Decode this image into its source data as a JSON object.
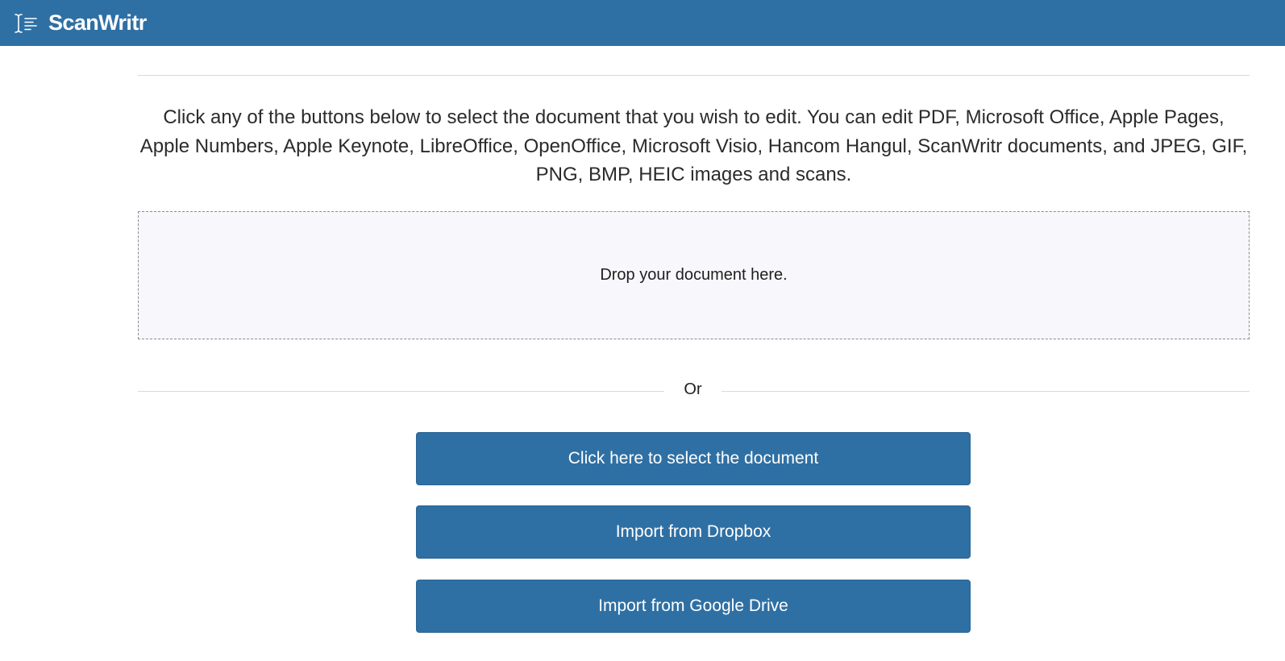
{
  "header": {
    "app_name": "ScanWritr",
    "logo_icon": "text-cursor-lines-icon",
    "bar_color": "#2f70a4"
  },
  "main": {
    "intro_text": "Click any of the buttons below to select the document that you wish to edit. You can edit PDF, Microsoft Office, Apple Pages, Apple Numbers, Apple Keynote, LibreOffice, OpenOffice, Microsoft Visio, Hancom Hangul, ScanWritr documents, and JPEG, GIF, PNG, BMP, HEIC images and scans.",
    "dropzone_text": "Drop your document here.",
    "separator_text": "Or",
    "buttons": {
      "select_label": "Click here to select the document",
      "dropbox_label": "Import from Dropbox",
      "gdrive_label": "Import from Google Drive"
    },
    "accent_color": "#2f70a4"
  }
}
